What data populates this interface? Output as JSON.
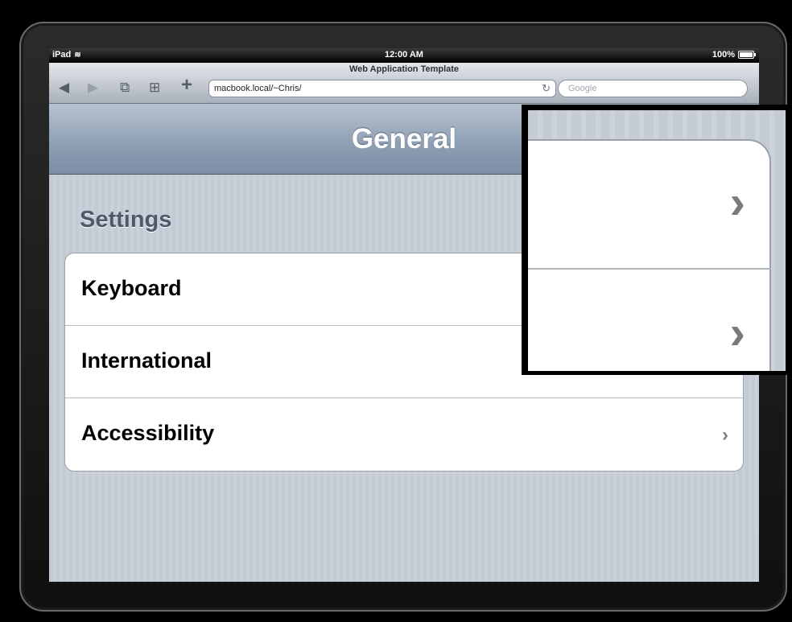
{
  "status_bar": {
    "device": "iPad",
    "time": "12:00 AM",
    "battery": "100%"
  },
  "browser": {
    "page_title": "Web Application Template",
    "url": "macbook.local/~Chris/",
    "search_placeholder": "Google",
    "icons": [
      "back-icon",
      "forward-icon",
      "pages-icon",
      "bookmarks-icon",
      "add-icon",
      "reload-icon"
    ]
  },
  "nav": {
    "title": "General"
  },
  "settings": {
    "section_header": "Settings",
    "rows": [
      {
        "label": "Keyboard"
      },
      {
        "label": "International"
      },
      {
        "label": "Accessibility"
      }
    ]
  },
  "glyphs": {
    "back": "◀",
    "forward": "▶",
    "add": "+",
    "reload": "↻",
    "chevron": "›",
    "pages": "⧉",
    "bookmarks": "⊞"
  },
  "colors": {
    "nav_gradient_top": "#b8c3d2",
    "nav_gradient_bottom": "#7d8ea5",
    "section_header": "#4e5a6b"
  }
}
